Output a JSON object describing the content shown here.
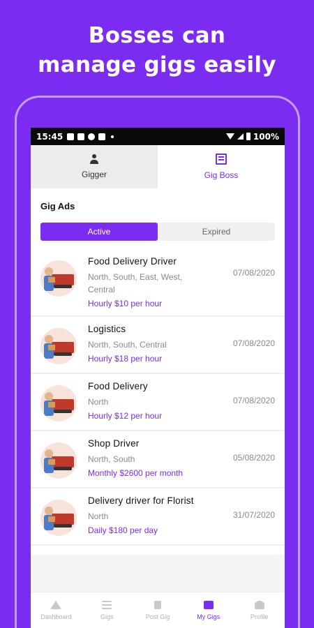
{
  "headline": {
    "line1": "Bosses can",
    "line2": "manage gigs easily"
  },
  "status_bar": {
    "time": "15:45",
    "battery": "100%"
  },
  "role_tabs": [
    {
      "label": "Gigger",
      "icon": "person-icon"
    },
    {
      "label": "Gig Boss",
      "icon": "building-icon"
    }
  ],
  "section_title": "Gig Ads",
  "filter": {
    "active": "Active",
    "expired": "Expired"
  },
  "gigs": [
    {
      "title": "Food Delivery Driver",
      "location": "North, South, East, West, Central",
      "pay": "Hourly $10 per hour",
      "date": "07/08/2020"
    },
    {
      "title": "Logistics",
      "location": "North, South, Central",
      "pay": "Hourly $18 per hour",
      "date": "07/08/2020"
    },
    {
      "title": "Food Delivery",
      "location": "North",
      "pay": "Hourly $12 per hour",
      "date": "07/08/2020"
    },
    {
      "title": "Shop Driver",
      "location": "North, South",
      "pay": "Monthly $2600 per month",
      "date": "05/08/2020"
    },
    {
      "title": "Delivery driver for Florist",
      "location": "North",
      "pay": "Daily $180 per day",
      "date": "31/07/2020"
    }
  ],
  "bottom_nav": [
    {
      "label": "Dashboard",
      "icon": "home-icon"
    },
    {
      "label": "Gigs",
      "icon": "list-icon"
    },
    {
      "label": "Post Gig",
      "icon": "upload-icon"
    },
    {
      "label": "My Gigs",
      "icon": "my-gigs-icon"
    },
    {
      "label": "Profile",
      "icon": "profile-icon"
    }
  ],
  "colors": {
    "brand": "#7a2cf0",
    "muted_text": "#8a8a8a"
  }
}
